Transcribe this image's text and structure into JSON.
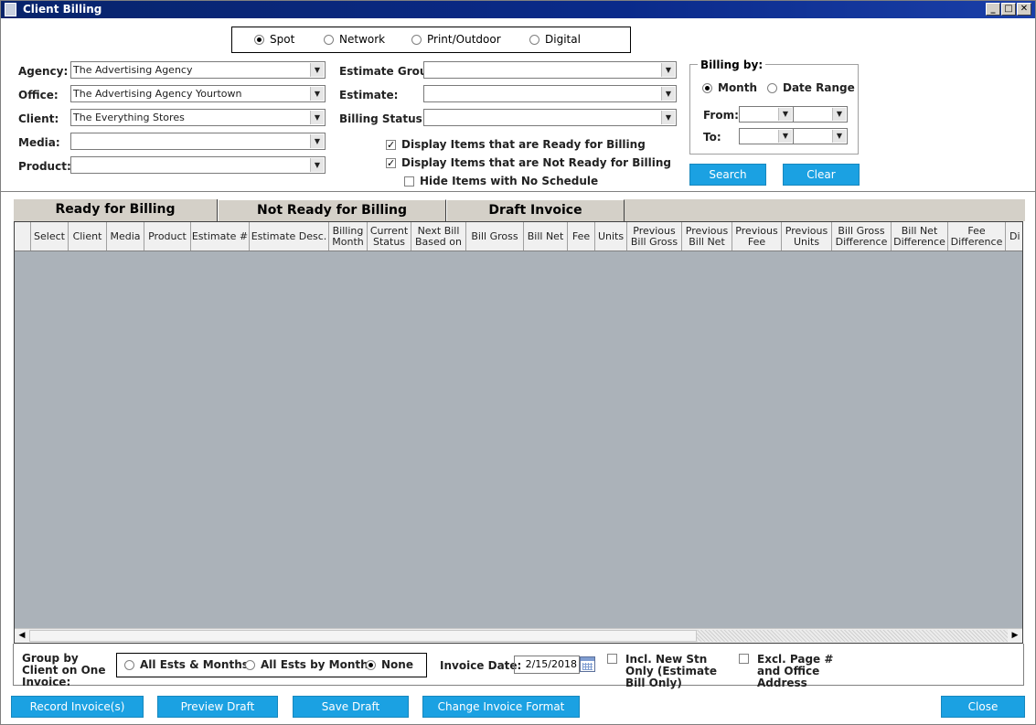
{
  "window": {
    "title": "Client Billing"
  },
  "media_types": [
    {
      "label": "Spot",
      "selected": true
    },
    {
      "label": "Network",
      "selected": false
    },
    {
      "label": "Print/Outdoor",
      "selected": false
    },
    {
      "label": "Digital",
      "selected": false
    }
  ],
  "filters": {
    "agency": {
      "label": "Agency:",
      "value": "The Advertising Agency"
    },
    "office": {
      "label": "Office:",
      "value": "The Advertising Agency Yourtown"
    },
    "client": {
      "label": "Client:",
      "value": "The Everything Stores"
    },
    "media": {
      "label": "Media:",
      "value": ""
    },
    "product": {
      "label": "Product:",
      "value": ""
    },
    "estimate_group": {
      "label": "Estimate Group:",
      "value": ""
    },
    "estimate": {
      "label": "Estimate:",
      "value": ""
    },
    "billing_status": {
      "label": "Billing Status:",
      "value": ""
    }
  },
  "display_options": [
    {
      "label": "Display Items that are Ready for Billing",
      "checked": true
    },
    {
      "label": "Display Items that are Not Ready for Billing",
      "checked": true
    },
    {
      "label": "Hide Items with No Schedule",
      "checked": false
    }
  ],
  "billing_by": {
    "legend": "Billing by:",
    "month_label": "Month",
    "date_range_label": "Date Range",
    "selected": "Month",
    "from_label": "From:",
    "to_label": "To:"
  },
  "buttons": {
    "search": "Search",
    "clear": "Clear"
  },
  "tabs": [
    {
      "label": "Ready for Billing",
      "active": true
    },
    {
      "label": "Not Ready for Billing",
      "active": false
    },
    {
      "label": "Draft Invoice",
      "active": false
    }
  ],
  "grid": {
    "columns": [
      "",
      "Select",
      "Client",
      "Media",
      "Product",
      "Estimate #",
      "Estimate Desc.",
      "Billing Month",
      "Current Status",
      "Next Bill Based on",
      "Bill Gross",
      "Bill Net",
      "Fee",
      "Units",
      "Previous Bill Gross",
      "Previous Bill Net",
      "Previous Fee",
      "Previous Units",
      "Bill Gross Difference",
      "Bill Net Difference",
      "Fee Difference",
      "Di"
    ],
    "rows": []
  },
  "footer": {
    "group_label": "Group by Client on One Invoice:",
    "group_options": [
      {
        "label": "All Ests & Months",
        "selected": false
      },
      {
        "label": "All Ests by Month",
        "selected": false
      },
      {
        "label": "None",
        "selected": true
      }
    ],
    "invoice_date_label": "Invoice Date:",
    "invoice_date": "2/15/2018",
    "incl_new_stn": {
      "label": "Incl. New Stn Only (Estimate Bill Only)",
      "checked": false
    },
    "excl_page": {
      "label": "Excl. Page # and Office Address",
      "checked": false
    }
  },
  "actions": {
    "record": "Record Invoice(s)",
    "preview": "Preview Draft",
    "save": "Save Draft",
    "change_format": "Change Invoice Format",
    "close": "Close"
  },
  "colors": {
    "accent": "#1ba1e2",
    "title_bar": "#0a2a8a",
    "grid_bg": "#abb2b9"
  }
}
